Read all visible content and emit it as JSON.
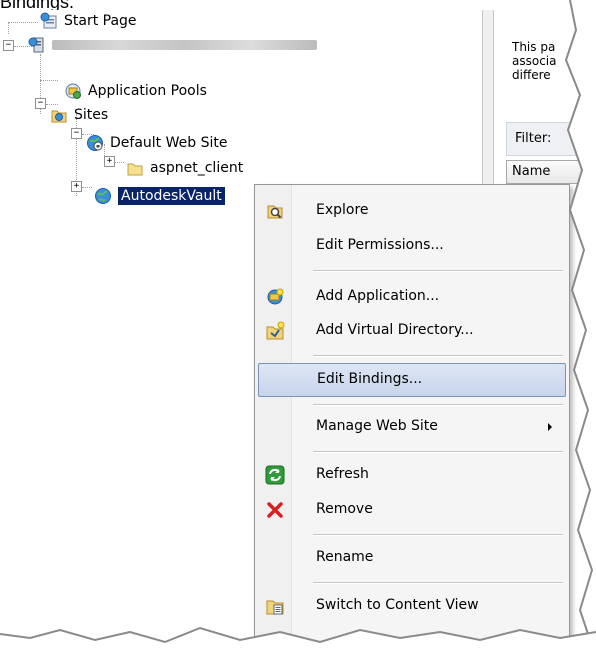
{
  "caption": "Bindings.",
  "tree": {
    "start_page": "Start Page",
    "server": "",
    "app_pools": "Application Pools",
    "sites": "Sites",
    "default_site": "Default Web Site",
    "aspnet_client": "aspnet_client",
    "autodesk_vault": "AutodeskVault"
  },
  "right_pane": {
    "line1": "This pa",
    "line2": "associa",
    "line3": "differe",
    "filter": "Filter:",
    "name_col": "Name"
  },
  "context_menu": {
    "items": [
      {
        "label": "Explore",
        "icon": "explore-icon"
      },
      {
        "label": "Edit Permissions...",
        "icon": ""
      },
      {
        "label": "Add Application...",
        "icon": "add-application-icon"
      },
      {
        "label": "Add Virtual Directory...",
        "icon": "add-virtual-directory-icon"
      },
      {
        "label": "Edit Bindings...",
        "icon": "",
        "highlighted": true
      },
      {
        "label": "Manage Web Site",
        "icon": "",
        "submenu": true
      },
      {
        "label": "Refresh",
        "icon": "refresh-icon"
      },
      {
        "label": "Remove",
        "icon": "remove-icon"
      },
      {
        "label": "Rename",
        "icon": ""
      },
      {
        "label": "Switch to Content View",
        "icon": "content-view-icon"
      }
    ]
  },
  "colors": {
    "selection": "#0a246a",
    "menu_bg": "#f5f5f5",
    "hover_border": "#7a93b7",
    "remove_red": "#d82020",
    "refresh_green": "#2e9a3a"
  }
}
